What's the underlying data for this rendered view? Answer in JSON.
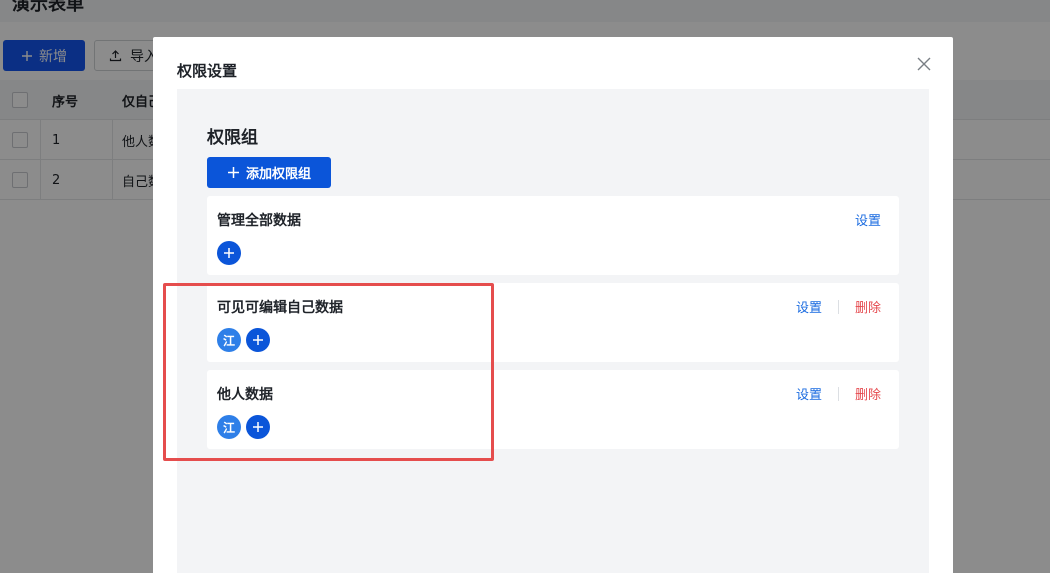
{
  "background": {
    "page_title": "演示表单",
    "new_button": "新增",
    "import_button": "导入",
    "table": {
      "headers": [
        "序号",
        "仅自己"
      ],
      "rows": [
        {
          "index": "1",
          "value": "他人数"
        },
        {
          "index": "2",
          "value": "自己数"
        }
      ]
    }
  },
  "modal": {
    "title": "权限设置",
    "section_title": "权限组",
    "add_group_button": "添加权限组",
    "groups": [
      {
        "name": "管理全部数据",
        "set_label": "设置",
        "members": []
      },
      {
        "name": "可见可编辑自己数据",
        "set_label": "设置",
        "delete_label": "删除",
        "members": [
          "江"
        ]
      },
      {
        "name": "他人数据",
        "set_label": "设置",
        "delete_label": "删除",
        "members": [
          "江"
        ]
      }
    ]
  },
  "colors": {
    "primary": "#0b55d9",
    "link": "#1a6be0",
    "danger": "#e5484d",
    "highlight": "#e54d4d"
  },
  "icons": {
    "close": "close-icon",
    "plus": "plus-icon",
    "upload": "upload-icon"
  }
}
